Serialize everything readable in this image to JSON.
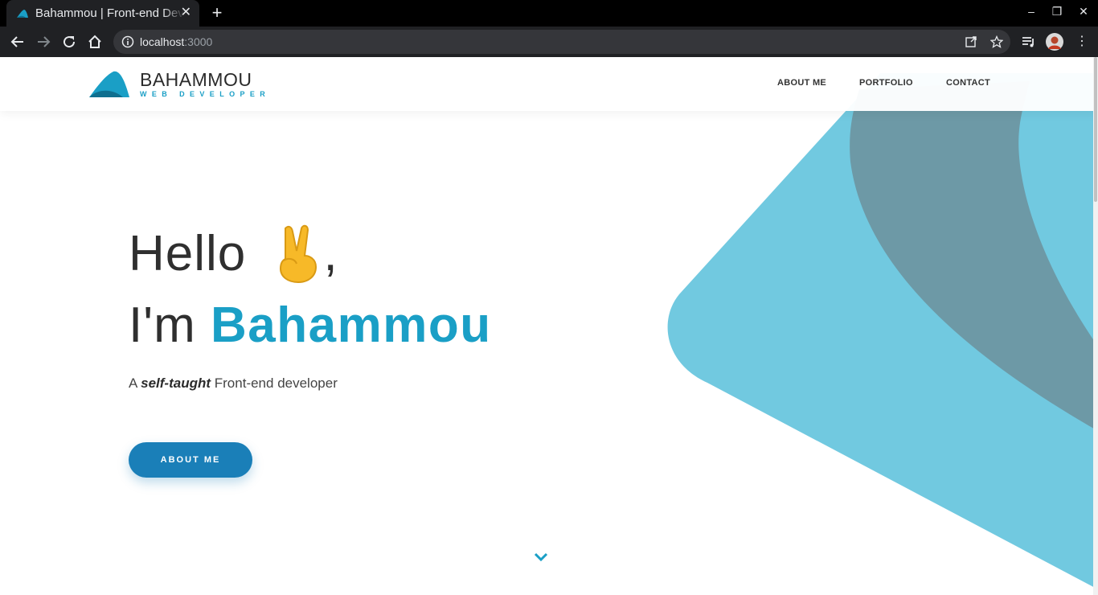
{
  "browser": {
    "tab_title": "Bahammou | Front-end Developer",
    "tab_close": "✕",
    "new_tab": "+",
    "url_host": "localhost",
    "url_port": ":3000",
    "window_controls": [
      "–",
      "❐",
      "✕"
    ]
  },
  "header": {
    "logo_name": "BAHAMMOU",
    "logo_sub": "WEB DEVELOPER",
    "nav": [
      "ABOUT ME",
      "PORTFOLIO",
      "CONTACT"
    ]
  },
  "hero": {
    "hello": "Hello",
    "comma": ",",
    "im": "I'm",
    "name": "Bahammou",
    "tagline_pre": "A",
    "tagline_em": "self-taught",
    "tagline_post": "Front-end developer",
    "cta": "ABOUT ME"
  },
  "colors": {
    "accent": "#1a9fc6",
    "button": "#1a7fb8",
    "shape_light": "#71c9e0",
    "shape_dark": "#6d99a6"
  },
  "icons": [
    "arrow-left-icon",
    "arrow-right-icon",
    "reload-icon",
    "home-icon",
    "info-icon",
    "open-external-icon",
    "star-icon",
    "media-queue-icon",
    "avatar",
    "chevron-down-icon"
  ]
}
